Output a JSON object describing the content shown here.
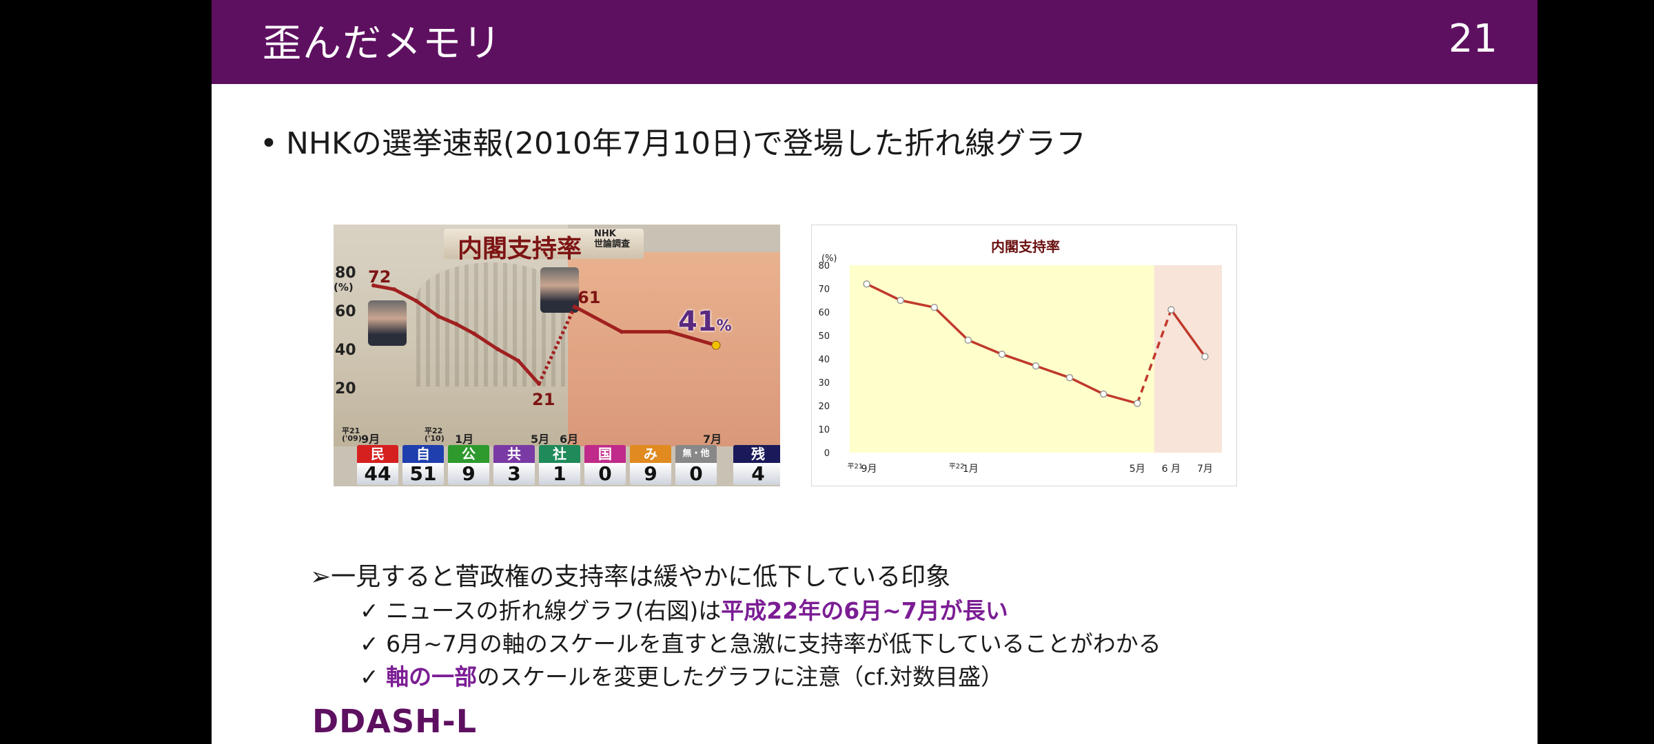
{
  "slide": {
    "title": "歪んだメモリ",
    "number": "21"
  },
  "bullet_main": {
    "marker": "•",
    "text": "NHKの選挙速報(2010年7月10日)で登場した折れ線グラフ"
  },
  "tv_graphic": {
    "title": "内閣支持率",
    "source_line1": "NHK",
    "source_line2": "世論調査",
    "y_unit": "(%)",
    "y_ticks": [
      "80",
      "60",
      "40",
      "20"
    ],
    "label_start": "72",
    "label_low": "21",
    "label_high": "61",
    "label_final": "41",
    "label_final_unit": "%",
    "x_labels": {
      "era1": "平21",
      "era1_year": "('09)",
      "sep": "9月",
      "era2": "平22",
      "era2_year": "('10)",
      "jan": "1月",
      "may": "5月",
      "jun": "6月",
      "jul": "7月"
    },
    "values": [
      72,
      70,
      64,
      56,
      52,
      47,
      39,
      33,
      21,
      61,
      48,
      48,
      41
    ],
    "parties": [
      {
        "name": "民",
        "seats": "44",
        "color": "#d62020"
      },
      {
        "name": "自",
        "seats": "51",
        "color": "#1f3fae"
      },
      {
        "name": "公",
        "seats": "9",
        "color": "#2e9a2e"
      },
      {
        "name": "共",
        "seats": "3",
        "color": "#7a3aa5"
      },
      {
        "name": "社",
        "seats": "1",
        "color": "#1f8a5a"
      },
      {
        "name": "国",
        "seats": "0",
        "color": "#c02a8a"
      },
      {
        "name": "み",
        "seats": "9",
        "color": "#e08a20"
      },
      {
        "name": "無・他",
        "seats": "0",
        "color": "#888888"
      },
      {
        "name": "残",
        "seats": "4",
        "color": "#1a1a5a"
      }
    ]
  },
  "chart_data": {
    "type": "line",
    "title": "内閣支持率",
    "ylabel": "(%)",
    "ylim": [
      0,
      80
    ],
    "yticks": [
      "0",
      "10",
      "20",
      "30",
      "40",
      "50",
      "60",
      "70",
      "80"
    ],
    "x_tick_labels": [
      {
        "era": "平21",
        "label": "9月"
      },
      {
        "era": "平22",
        "label": "1月"
      },
      {
        "era": "",
        "label": "5月"
      },
      {
        "era": "",
        "label": "6 月"
      },
      {
        "era": "",
        "label": "7月"
      }
    ],
    "series": [
      {
        "values": [
          72,
          65,
          62,
          48,
          42,
          37,
          32,
          25,
          21,
          61,
          41
        ],
        "color": "#c0392b",
        "dashed_segment": [
          8,
          9
        ]
      }
    ],
    "shaded_regions": [
      {
        "from_index": 0,
        "to_index": 8,
        "color": "#ffffcc"
      },
      {
        "from_index": 9,
        "to_index": 10,
        "color": "#f8e4d8"
      }
    ],
    "grid": false
  },
  "sub_bullets": {
    "main": "➢一見すると菅政権の支持率は緩やかに低下している印象",
    "items": [
      {
        "check": "✓",
        "text": "ニュースの折れ線グラフ(右図)は",
        "highlight": "平成22年の6月~7月が長い",
        "after": ""
      },
      {
        "check": "✓",
        "text": "6月~7月の軸のスケールを直すと急激に支持率が低下していることがわかる",
        "highlight": "",
        "after": ""
      },
      {
        "check": "✓",
        "text": "",
        "highlight": "軸の一部",
        "after": "のスケールを変更したグラフに注意（cf.対数目盛）"
      }
    ]
  },
  "logo": "DDASH-L",
  "colors": {
    "header": "#5e1060",
    "highlight": "#7b1d94",
    "line": "#c0392b"
  }
}
